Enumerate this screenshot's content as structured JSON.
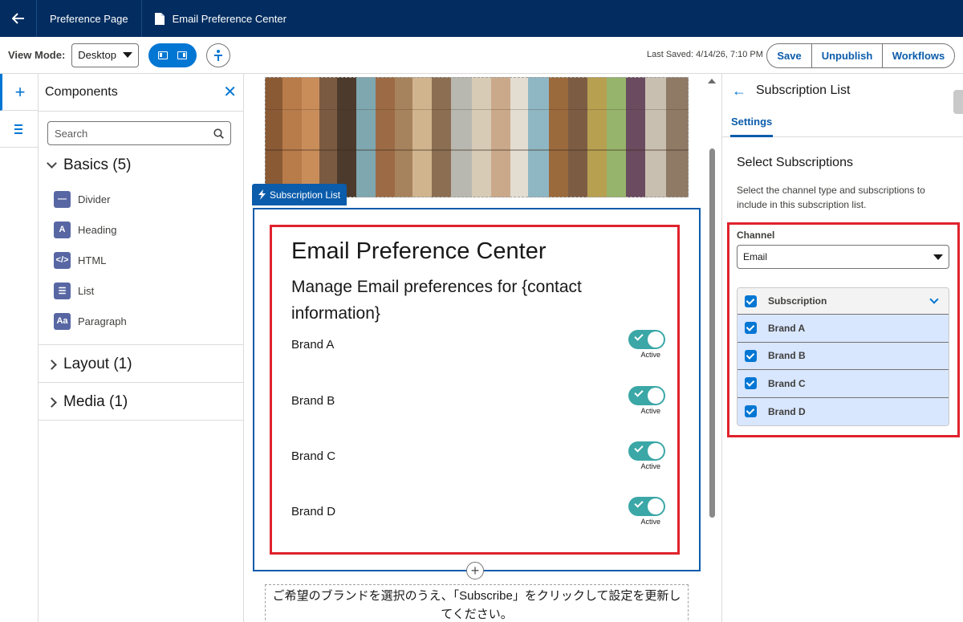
{
  "topbar": {
    "title": "Preference Page",
    "document": "Email Preference Center"
  },
  "toolbar": {
    "view_mode_label": "View Mode:",
    "view_mode_value": "Desktop",
    "last_saved": "Last Saved: 4/14/26, 7:10 PM",
    "save_label": "Save",
    "unpublish_label": "Unpublish",
    "workflows_label": "Workflows"
  },
  "components": {
    "title": "Components",
    "search_placeholder": "Search",
    "basics_label": "Basics (5)",
    "basics_items": [
      {
        "label": "Divider",
        "icon": "divider-icon",
        "glyph": "—"
      },
      {
        "label": "Heading",
        "icon": "heading-icon",
        "glyph": "A"
      },
      {
        "label": "HTML",
        "icon": "html-icon",
        "glyph": "</>"
      },
      {
        "label": "List",
        "icon": "list-icon",
        "glyph": "☰"
      },
      {
        "label": "Paragraph",
        "icon": "paragraph-icon",
        "glyph": "Aa"
      }
    ],
    "layout_label": "Layout (1)",
    "media_label": "Media (1)"
  },
  "canvas": {
    "badge_label": "Subscription List",
    "title": "Email Preference Center",
    "description": "Manage Email preferences for {contact information}",
    "brands": [
      {
        "name": "Brand A",
        "status": "Active"
      },
      {
        "name": "Brand B",
        "status": "Active"
      },
      {
        "name": "Brand C",
        "status": "Active"
      },
      {
        "name": "Brand D",
        "status": "Active"
      }
    ],
    "footer_text": "ご希望のブランドを選択のうえ、「Subscribe」をクリックして設定を更新してください。"
  },
  "settings": {
    "panel_title": "Subscription List",
    "tab_label": "Settings",
    "section_title": "Select Subscriptions",
    "help_text": "Select the channel type and subscriptions to include in this subscription list.",
    "channel_label": "Channel",
    "channel_value": "Email",
    "subscription_header": "Subscription",
    "subscriptions": [
      "Brand A",
      "Brand B",
      "Brand C",
      "Brand D"
    ]
  },
  "colors": {
    "header_navy": "#032d60",
    "brand_blue": "#0176d3",
    "highlight_red": "#e0222c",
    "toggle_teal": "#3ba7a7",
    "selected_row": "#d8e6fe"
  }
}
